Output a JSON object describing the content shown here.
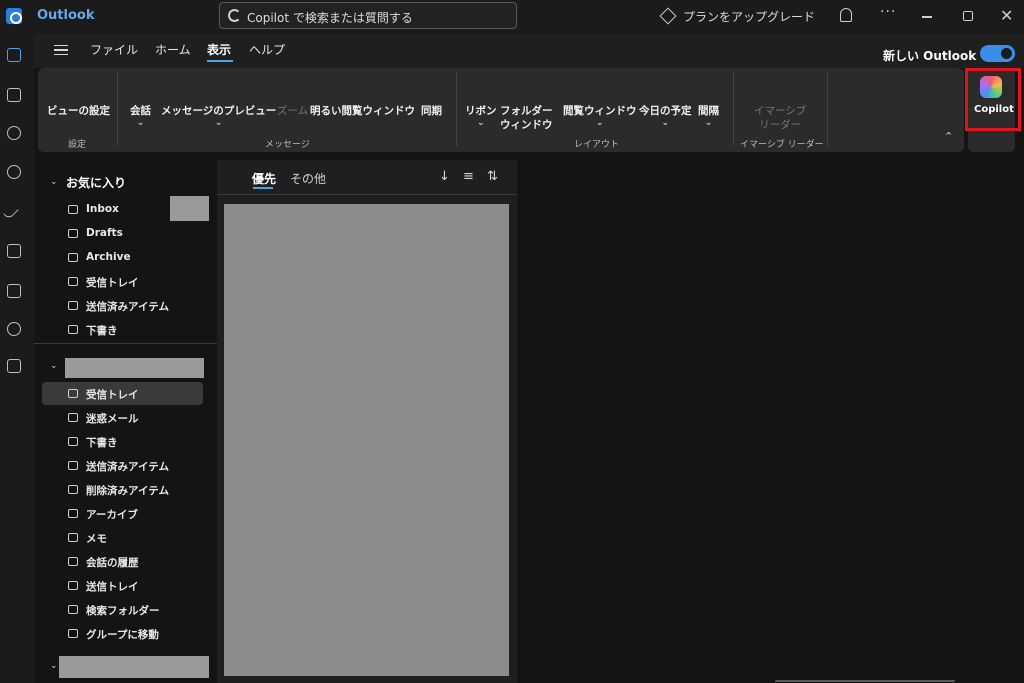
{
  "app": {
    "name": "Outlook"
  },
  "titlebar": {
    "search_text": "Copilot で検索または質問する",
    "upgrade_text": "プランをアップグレード",
    "more": "···",
    "close": "✕"
  },
  "rail": {
    "items": [
      "mail-icon",
      "calendar-icon",
      "copilot-icon",
      "people-icon",
      "todo-icon",
      "word-icon",
      "excel-icon",
      "onedrive-icon",
      "apps-icon"
    ]
  },
  "menu": {
    "tabs": [
      "ファイル",
      "ホーム",
      "表示",
      "ヘルプ"
    ],
    "active_tab": "表示",
    "new_outlook_label": "新しい Outlook",
    "new_outlook_enabled": true
  },
  "ribbon": {
    "view_settings": "ビューの設定",
    "group_settings": "設定",
    "conversation": "会話",
    "message_preview": "メッセージのプレビュー",
    "zoom": "ズーム",
    "bright_reading": "明るい閲覧ウィンドウ",
    "sync": "同期",
    "group_message": "メッセージ",
    "ribbon": "リボン",
    "folder_pane_1": "フォルダー",
    "folder_pane_2": "ウィンドウ",
    "reading_pane": "閲覧ウィンドウ",
    "today_schedule": "今日の予定",
    "spacing": "間隔",
    "group_layout": "レイアウト",
    "immersive_1": "イマーシブ",
    "immersive_2": "リーダー",
    "group_immersive": "イマーシブ リーダー",
    "copilot_label": "Copilot",
    "chevron": "⌄",
    "collapse": "⌃"
  },
  "folders": {
    "favorites_header": "お気に入り",
    "favorites": [
      {
        "label": "Inbox",
        "icon": "inbox-icon"
      },
      {
        "label": "Drafts",
        "icon": "pencil-icon"
      },
      {
        "label": "Archive",
        "icon": "archive-icon"
      },
      {
        "label": "受信トレイ",
        "icon": "inbox-icon"
      },
      {
        "label": "送信済みアイテム",
        "icon": "send-icon"
      },
      {
        "label": "下書き",
        "icon": "pencil-icon"
      }
    ],
    "account": [
      {
        "label": "受信トレイ",
        "icon": "inbox-icon"
      },
      {
        "label": "迷惑メール",
        "icon": "junk-icon"
      },
      {
        "label": "下書き",
        "icon": "pencil-icon"
      },
      {
        "label": "送信済みアイテム",
        "icon": "send-icon"
      },
      {
        "label": "削除済みアイテム",
        "icon": "trash-icon"
      },
      {
        "label": "アーカイブ",
        "icon": "archive-icon"
      },
      {
        "label": "メモ",
        "icon": "note-icon"
      },
      {
        "label": "会話の履歴",
        "icon": "folder-icon"
      },
      {
        "label": "送信トレイ",
        "icon": "outbox-icon"
      },
      {
        "label": "検索フォルダー",
        "icon": "search-folder-icon"
      },
      {
        "label": "グループに移動",
        "icon": "group-icon"
      }
    ],
    "selected": "受信トレイ"
  },
  "message_list": {
    "tabs": [
      "優先",
      "その他"
    ],
    "active_tab": "優先",
    "tools": [
      "↓",
      "≡",
      "⇅"
    ]
  },
  "colors": {
    "accent": "#4fa0f0",
    "highlight": "#e0141e",
    "brand": "#69a8ec"
  }
}
